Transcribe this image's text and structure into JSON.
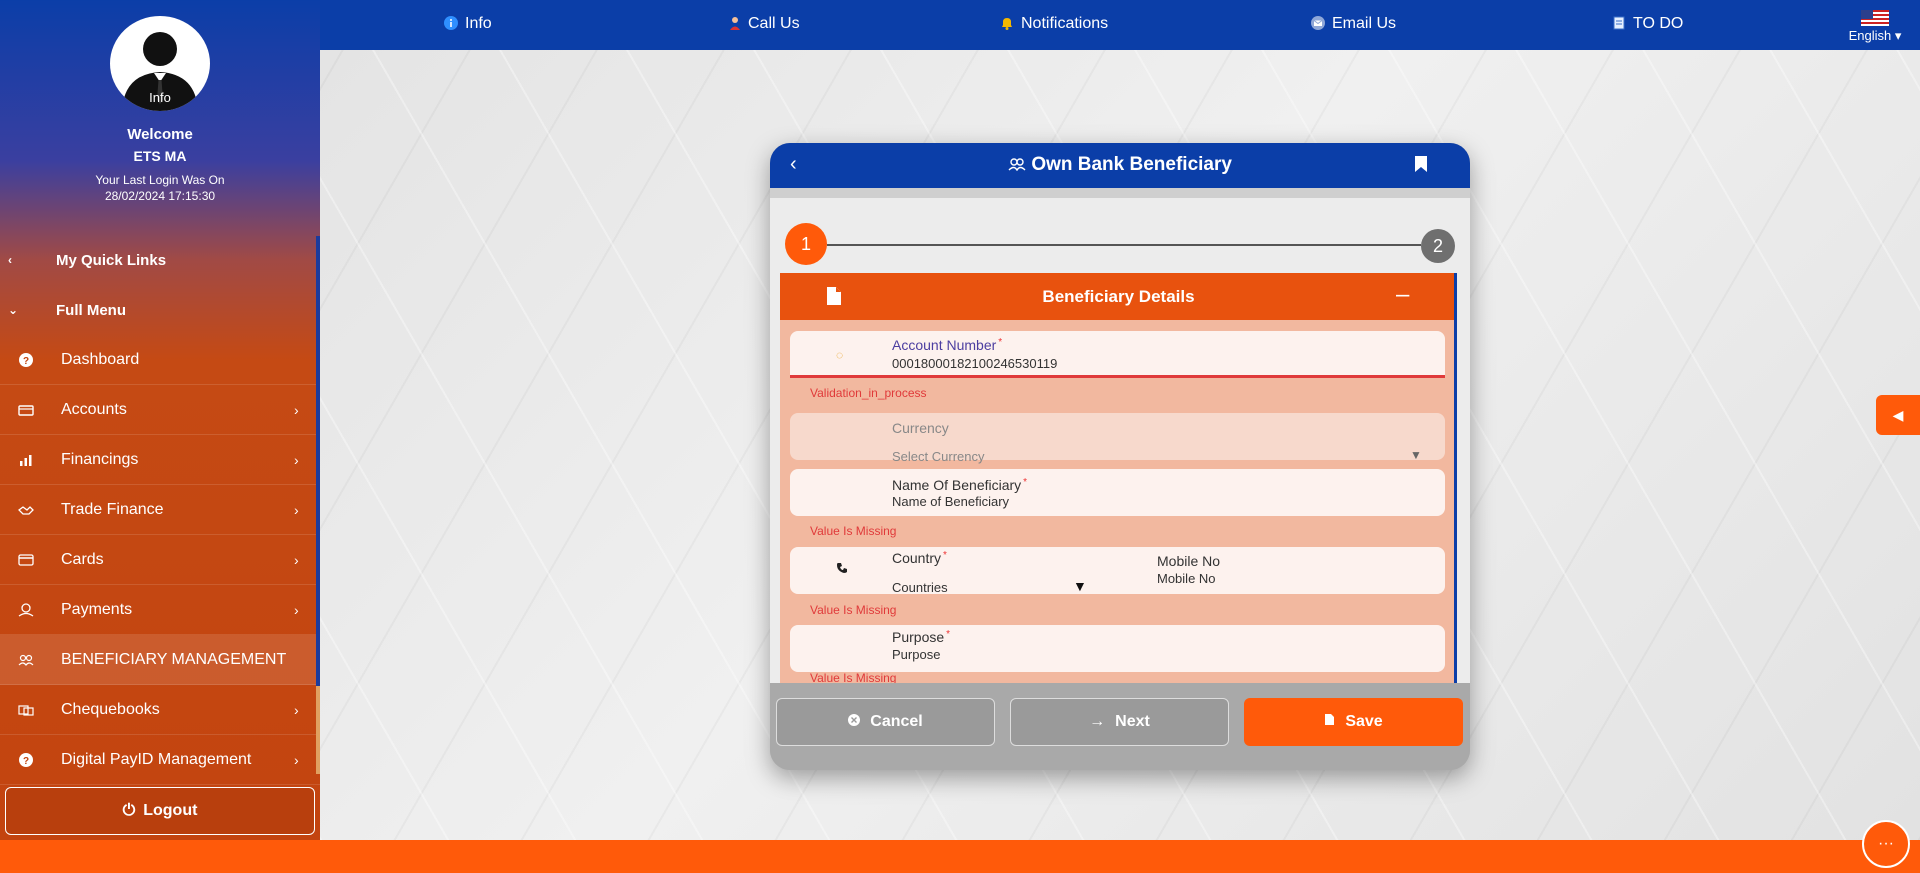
{
  "profile": {
    "avatar_label": "Info",
    "welcome": "Welcome",
    "username": "ETS MA",
    "last_login_label": "Your Last Login Was On",
    "last_login_value": "28/02/2024 17:15:30"
  },
  "sidebar": {
    "quick_links": "My Quick Links",
    "full_menu": "Full Menu",
    "items": [
      {
        "label": "Dashboard",
        "icon": "help-circle-icon"
      },
      {
        "label": "Accounts",
        "icon": "wallet-icon"
      },
      {
        "label": "Financings",
        "icon": "chart-icon"
      },
      {
        "label": "Trade Finance",
        "icon": "handshake-icon"
      },
      {
        "label": "Cards",
        "icon": "card-icon"
      },
      {
        "label": "Payments",
        "icon": "payment-icon"
      },
      {
        "label": "BENEFICIARY MANAGEMENT",
        "icon": "users-icon"
      },
      {
        "label": "Chequebooks",
        "icon": "chequebook-icon"
      },
      {
        "label": "Digital PayID Management",
        "icon": "help-circle-icon"
      }
    ],
    "logout": "Logout"
  },
  "topbar": {
    "items": [
      {
        "label": "Info",
        "icon": "info-icon"
      },
      {
        "label": "Call Us",
        "icon": "agent-icon"
      },
      {
        "label": "Notifications",
        "icon": "bell-icon"
      },
      {
        "label": "Email Us",
        "icon": "mail-icon"
      },
      {
        "label": "TO DO",
        "icon": "notepad-icon"
      }
    ],
    "language": "English"
  },
  "dialog": {
    "title": "Own Bank Beneficiary",
    "steps": [
      "1",
      "2"
    ],
    "section_title": "Beneficiary Details",
    "fields": {
      "account_number": {
        "label": "Account Number",
        "value": "00018000182100246530119",
        "error": "Validation_in_process"
      },
      "currency": {
        "label": "Currency",
        "placeholder": "Select Currency"
      },
      "beneficiary_name": {
        "label": "Name Of Beneficiary",
        "placeholder": "Name of Beneficiary",
        "error": "Value Is Missing"
      },
      "country": {
        "label": "Country",
        "placeholder": "Countries",
        "error": "Value Is Missing"
      },
      "mobile": {
        "label": "Mobile No",
        "placeholder": "Mobile No"
      },
      "purpose": {
        "label": "Purpose",
        "placeholder": "Purpose",
        "error": "Value Is Missing"
      }
    },
    "buttons": {
      "cancel": "Cancel",
      "next": "Next",
      "save": "Save"
    }
  },
  "colors": {
    "primary_blue": "#0b3ea8",
    "accent_orange": "#ff5a0a",
    "error_red": "#e03a3a"
  }
}
